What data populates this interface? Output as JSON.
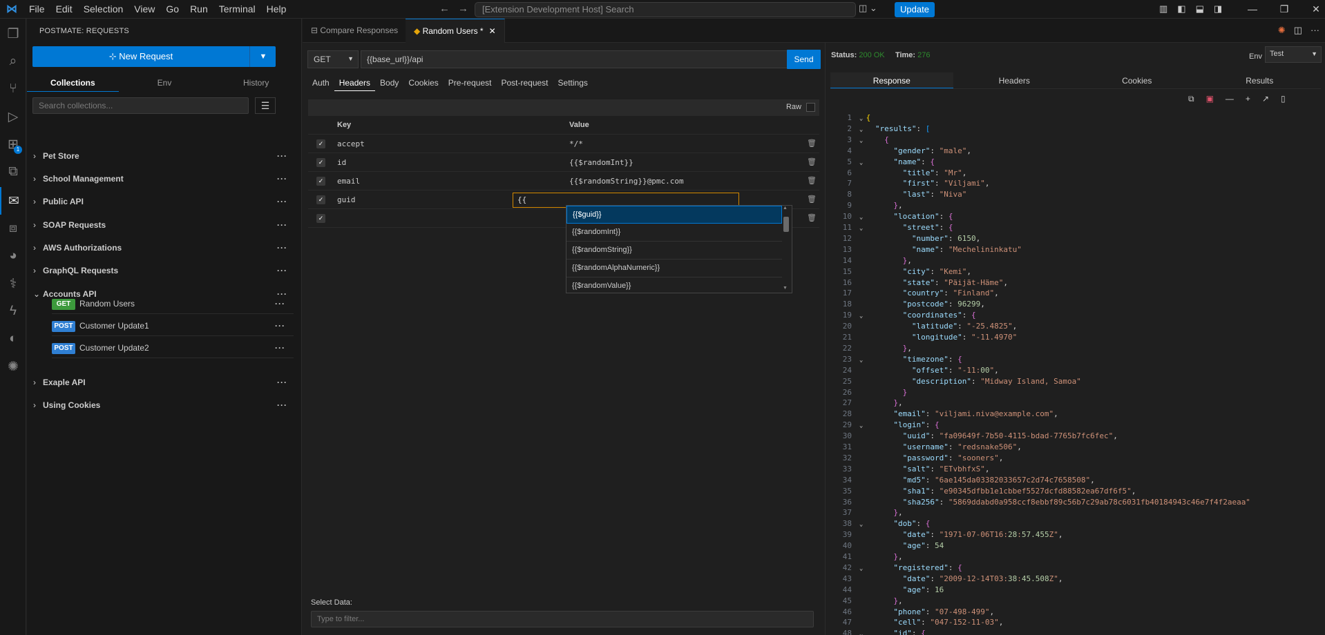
{
  "titlebar": {
    "menu": [
      "File",
      "Edit",
      "Selection",
      "View",
      "Go",
      "Run",
      "Terminal",
      "Help"
    ],
    "search_placeholder": "[Extension Development Host] Search",
    "update_label": "Update"
  },
  "sidebar": {
    "title": "POSTMATE: REQUESTS",
    "new_request_label": "New Request",
    "tabs": [
      "Collections",
      "Env",
      "History"
    ],
    "search_placeholder": "Search collections...",
    "collections": [
      {
        "name": "Pet Store",
        "expanded": false
      },
      {
        "name": "School Management",
        "expanded": false
      },
      {
        "name": "Public API",
        "expanded": false
      },
      {
        "name": "SOAP Requests",
        "expanded": false
      },
      {
        "name": "AWS Authorizations",
        "expanded": false
      },
      {
        "name": "GraphQL Requests",
        "expanded": false
      },
      {
        "name": "Accounts API",
        "expanded": true
      },
      {
        "name": "Exaple API",
        "expanded": false
      },
      {
        "name": "Using Cookies",
        "expanded": false
      }
    ],
    "requests": [
      {
        "method": "GET",
        "name": "Random Users",
        "color": "#3c9a3c"
      },
      {
        "method": "POST",
        "name": "Customer Update1",
        "color": "#2f7fd3"
      },
      {
        "method": "POST",
        "name": "Customer Update2",
        "color": "#2f7fd3"
      }
    ]
  },
  "tabs": [
    {
      "label": "Compare Responses",
      "active": false
    },
    {
      "label": "Random Users *",
      "active": true
    }
  ],
  "request": {
    "method": "GET",
    "url": "{{base_url}}/api",
    "send_label": "Send",
    "tabs": [
      "Auth",
      "Headers",
      "Body",
      "Cookies",
      "Pre-request",
      "Post-request",
      "Settings"
    ],
    "active_tab": "Headers",
    "raw_label": "Raw",
    "headers_columns": [
      "Key",
      "Value"
    ],
    "headers": [
      {
        "key": "accept",
        "value": "*/*",
        "checked": true
      },
      {
        "key": "id",
        "value": "{{$randomInt}}",
        "checked": true
      },
      {
        "key": "email",
        "value": "{{$randomString}}@pmc.com",
        "checked": true
      },
      {
        "key": "guid",
        "value": "{{",
        "checked": true
      },
      {
        "key": "",
        "value": "",
        "checked": true
      }
    ],
    "suggestions": [
      "{{$guid}}",
      "{{$randomInt}}",
      "{{$randomString}}",
      "{{$randomAlphaNumeric}}",
      "{{$randomValue}}"
    ],
    "select_data_label": "Select Data:",
    "filter_placeholder": "Type to filter..."
  },
  "response": {
    "status_label": "Status:",
    "status_value": "200 OK",
    "time_label": "Time:",
    "time_value": "276",
    "env_label": "Env",
    "env_value": "Test",
    "tabs": [
      "Response",
      "Headers",
      "Cookies",
      "Results"
    ],
    "active_tab": "Response"
  },
  "icons": {
    "activity": [
      "files-icon",
      "search-icon",
      "source-control-icon",
      "run-debug-icon",
      "extensions-icon",
      "remote-explorer-icon",
      "postmate-icon",
      "testing-icon",
      "database-icon",
      "python-icon",
      "thunder-icon",
      "gitlens-icon",
      "sparkle-icon"
    ]
  }
}
